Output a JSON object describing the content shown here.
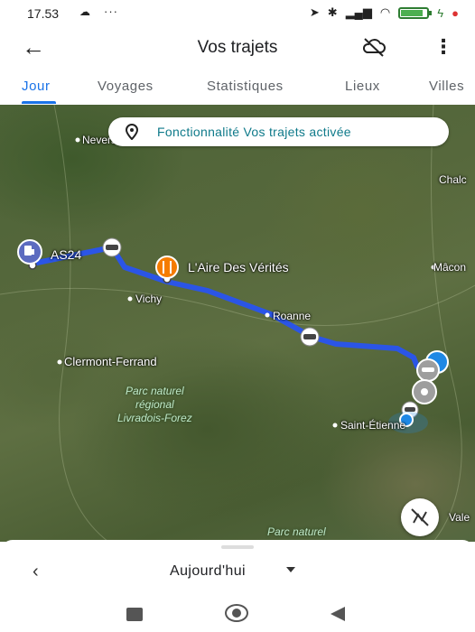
{
  "status_bar": {
    "time": "17.53",
    "cloud_icon": "cloud-icon",
    "overflow": "···"
  },
  "app_bar": {
    "back_icon": "arrow-left-icon",
    "title": "Vos trajets",
    "cloud_off_icon": "cloud-off-icon",
    "more_icon": "more-vert-icon"
  },
  "tabs": [
    {
      "label": "Jour",
      "active": true
    },
    {
      "label": "Voyages"
    },
    {
      "label": "Statistiques"
    },
    {
      "label": "Lieux"
    },
    {
      "label": "Villes"
    }
  ],
  "map": {
    "banner": "Fonctionnalité Vos trajets activée",
    "cities": {
      "nevers": "Nevers",
      "chalon": "Chalc",
      "macon": "Mâcon",
      "vichy": "Vichy",
      "roanne": "Roanne",
      "clermont": "Clermont-Ferrand",
      "saint_etienne": "Saint-Étienne",
      "vale": "Vale"
    },
    "park1": [
      "Parc naturel",
      "régional",
      "Livradois-Forez"
    ],
    "park2": "Parc naturel",
    "poi_as24": "AS24",
    "poi_aire": "L'Aire Des Vérités",
    "route_color": "#2b55e6",
    "accent": "#1a73e8"
  },
  "bottom_sheet": {
    "prev_icon": "chevron-left-icon",
    "date_label": "Aujourd'hui"
  },
  "nav_bar": {
    "recents": "recents-icon",
    "home": "home-icon",
    "back": "back-icon"
  }
}
